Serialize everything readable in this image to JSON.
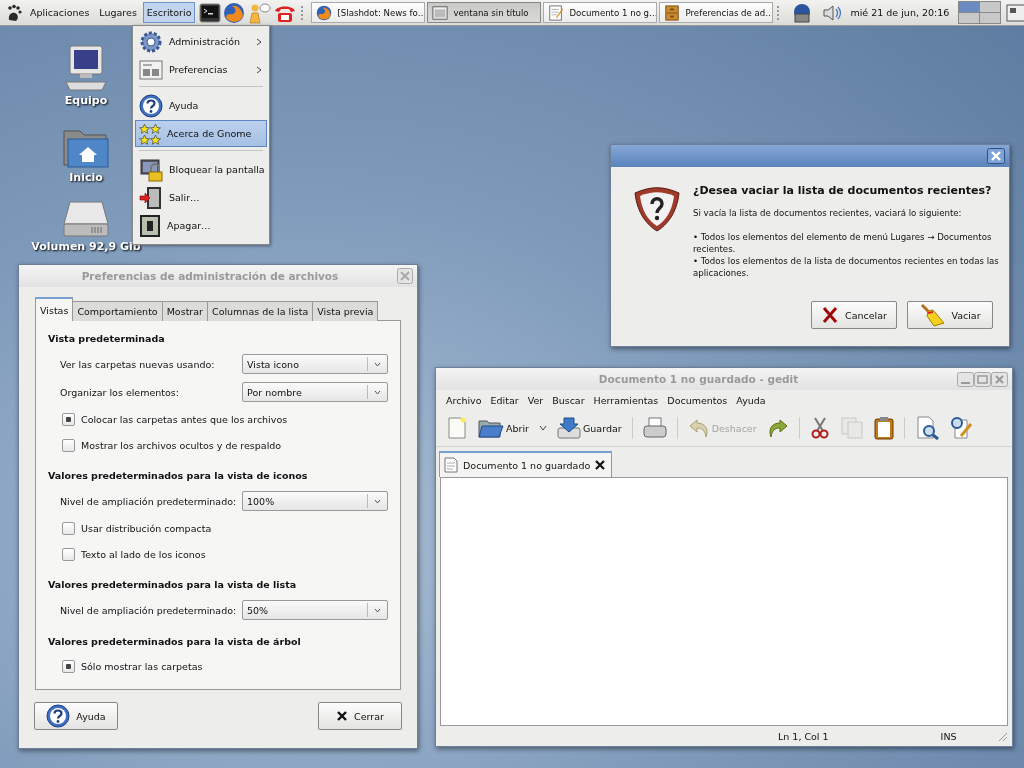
{
  "top_panel": {
    "menus": [
      {
        "label": "Aplicaciones",
        "selected": false
      },
      {
        "label": "Lugares",
        "selected": false
      },
      {
        "label": "Escritorio",
        "selected": true
      }
    ],
    "tasks": [
      {
        "label": "[Slashdot: News fo…",
        "selected": false
      },
      {
        "label": "ventana sin título",
        "selected": true
      },
      {
        "label": "Documento 1 no g…",
        "selected": false
      },
      {
        "label": "Preferencias de ad…",
        "selected": false
      }
    ],
    "clock": "mié 21 de jun, 20:16",
    "workspaces": [
      {
        "selected": true
      },
      {
        "selected": false
      },
      {
        "selected": false
      },
      {
        "selected": false
      }
    ]
  },
  "desktop_icons": [
    {
      "kind": "computer",
      "label": "Equipo"
    },
    {
      "kind": "home",
      "label": "Inicio"
    },
    {
      "kind": "drive",
      "label": "Volumen 92,9 Gib"
    }
  ],
  "desktop_menu": {
    "items": [
      {
        "kind": "item",
        "label": "Administración",
        "submenu": true,
        "selected": false
      },
      {
        "kind": "item",
        "label": "Preferencias",
        "submenu": true,
        "selected": false
      },
      {
        "kind": "separator"
      },
      {
        "kind": "item",
        "label": "Ayuda",
        "submenu": false,
        "selected": false
      },
      {
        "kind": "item",
        "label": "Acerca de Gnome",
        "submenu": false,
        "selected": true
      },
      {
        "kind": "separator"
      },
      {
        "kind": "item",
        "label": "Bloquear la pantalla",
        "submenu": false,
        "selected": false
      },
      {
        "kind": "item",
        "label": "Salir…",
        "submenu": false,
        "selected": false
      },
      {
        "kind": "item",
        "label": "Apagar…",
        "submenu": false,
        "selected": false
      }
    ]
  },
  "prefs_dialog": {
    "title": "Preferencias de administración de archivos",
    "tabs": [
      {
        "label": "Vistas",
        "selected": true
      },
      {
        "label": "Comportamiento",
        "selected": false
      },
      {
        "label": "Mostrar",
        "selected": false
      },
      {
        "label": "Columnas de la lista",
        "selected": false
      },
      {
        "label": "Vista previa",
        "selected": false
      }
    ],
    "sections": [
      {
        "heading": "Vista predeterminada",
        "rows": [
          {
            "kind": "combo",
            "label": "Ver las carpetas nuevas usando:",
            "value": "Vista icono"
          },
          {
            "kind": "combo",
            "label": "Organizar los elementos:",
            "value": "Por nombre"
          },
          {
            "kind": "check",
            "label": "Colocar las carpetas antes que los archivos",
            "checked": true
          },
          {
            "kind": "check",
            "label": "Mostrar los archivos ocultos y de respaldo",
            "checked": false
          }
        ]
      },
      {
        "heading": "Valores predeterminados para la vista de iconos",
        "rows": [
          {
            "kind": "combo",
            "label": "Nivel de ampliación predeterminado:",
            "value": "100%"
          },
          {
            "kind": "check",
            "label": "Usar distribución compacta",
            "checked": false
          },
          {
            "kind": "check",
            "label": "Texto al lado de los iconos",
            "checked": false
          }
        ]
      },
      {
        "heading": "Valores predeterminados para la vista de lista",
        "rows": [
          {
            "kind": "combo",
            "label": "Nivel de ampliación predeterminado:",
            "value": "50%"
          }
        ]
      },
      {
        "heading": "Valores predeterminados para la vista de árbol",
        "rows": [
          {
            "kind": "check",
            "label": "Sólo mostrar las carpetas",
            "checked": true
          }
        ]
      }
    ],
    "buttons": [
      {
        "kind": "help",
        "label": "Ayuda"
      },
      {
        "kind": "close",
        "label": "Cerrar"
      }
    ]
  },
  "confirm_dialog": {
    "heading": "¿Desea vaciar la lista de documentos recientes?",
    "body": "Si vacía la lista de documentos recientes, vaciará lo siguiente:",
    "bullets": [
      "• Todos los elementos del elemento de menú Lugares → Documentos recientes.",
      "• Todos los elementos de la lista de documentos recientes en todas las aplicaciones."
    ],
    "buttons": [
      {
        "kind": "cancel",
        "label": "Cancelar"
      },
      {
        "kind": "clear",
        "label": "Vaciar"
      }
    ]
  },
  "gedit": {
    "title": "Documento 1 no guardado - gedit",
    "menu": [
      "Archivo",
      "Editar",
      "Ver",
      "Buscar",
      "Herramientas",
      "Documentos",
      "Ayuda"
    ],
    "toolbar": [
      {
        "kind": "new",
        "disabled": false
      },
      {
        "kind": "open",
        "label": "Abrir",
        "disabled": false
      },
      {
        "kind": "dropdown",
        "disabled": false
      },
      {
        "kind": "save",
        "label": "Guardar",
        "disabled": false
      },
      {
        "kind": "separator"
      },
      {
        "kind": "print",
        "disabled": false
      },
      {
        "kind": "separator"
      },
      {
        "kind": "undo",
        "label": "Deshacer",
        "disabled": true
      },
      {
        "kind": "redo",
        "disabled": false
      },
      {
        "kind": "separator"
      },
      {
        "kind": "cut",
        "disabled": false
      },
      {
        "kind": "copy",
        "disabled": true
      },
      {
        "kind": "paste",
        "disabled": false
      },
      {
        "kind": "separator"
      },
      {
        "kind": "find",
        "disabled": false
      },
      {
        "kind": "replace",
        "disabled": false
      }
    ],
    "tabs": [
      {
        "label": "Documento 1 no guardado",
        "selected": true
      }
    ],
    "status": {
      "position": "Ln 1, Col 1",
      "mode": "INS"
    }
  }
}
